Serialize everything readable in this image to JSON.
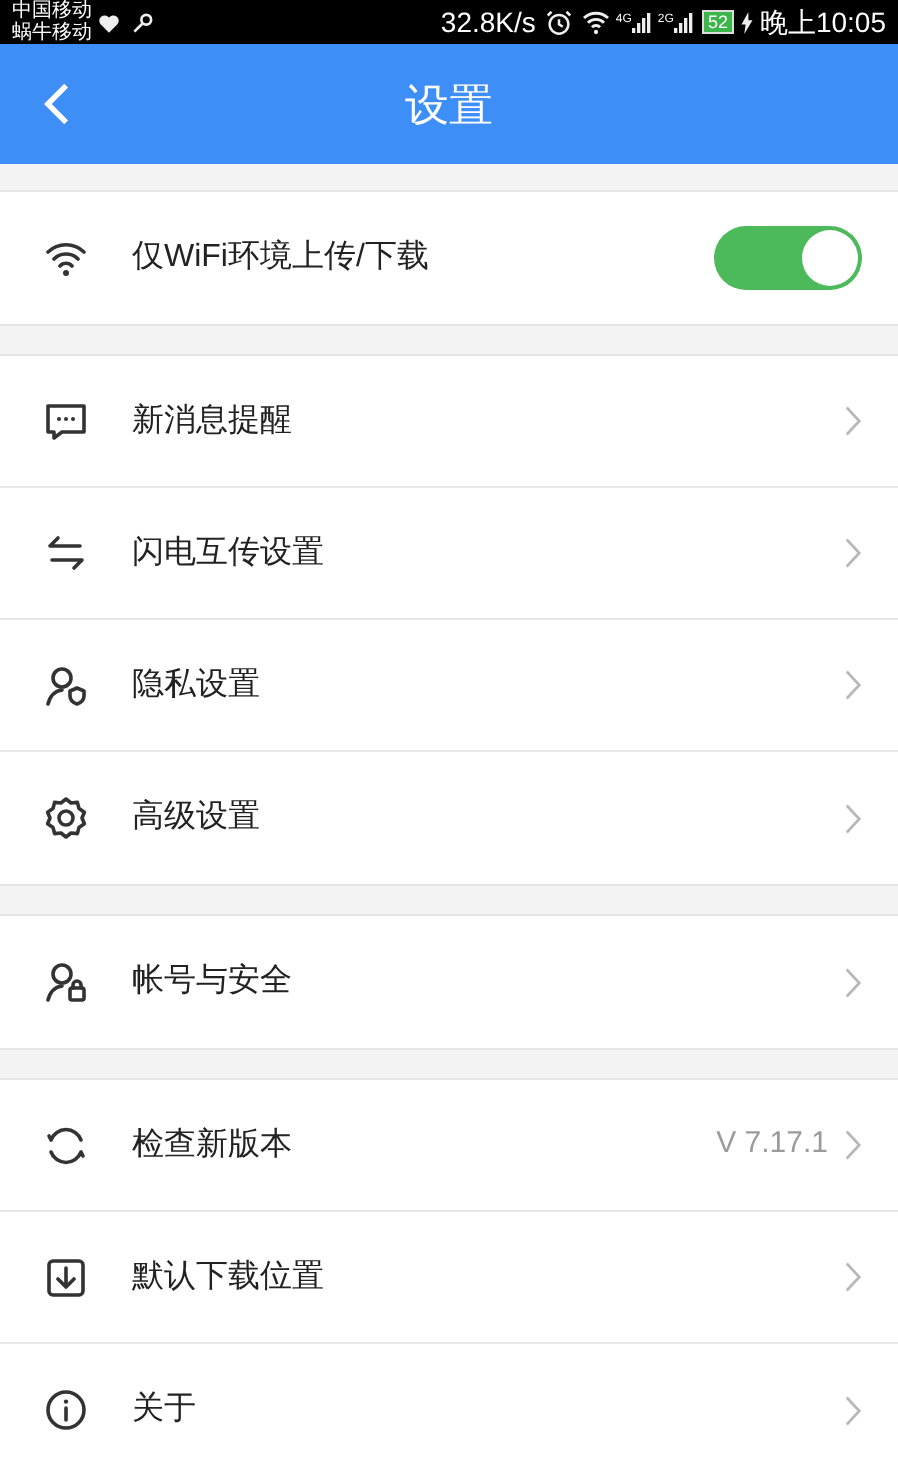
{
  "status_bar": {
    "carriers": [
      "中国移动",
      "蜗牛移动"
    ],
    "speed": "32.8K/s",
    "network_1": "4G",
    "network_2": "2G",
    "battery": "52",
    "time": "晚上10:05"
  },
  "header": {
    "title": "设置"
  },
  "sections": [
    {
      "items": [
        {
          "kind": "toggle",
          "label": "仅WiFi环境上传/下载",
          "on": true
        }
      ]
    },
    {
      "items": [
        {
          "kind": "link",
          "label": "新消息提醒"
        },
        {
          "kind": "link",
          "label": "闪电互传设置"
        },
        {
          "kind": "link",
          "label": "隐私设置"
        },
        {
          "kind": "link",
          "label": "高级设置"
        }
      ]
    },
    {
      "items": [
        {
          "kind": "link",
          "label": "帐号与安全"
        }
      ]
    },
    {
      "items": [
        {
          "kind": "link",
          "label": "检查新版本",
          "value": "V 7.17.1"
        },
        {
          "kind": "link",
          "label": "默认下载位置"
        },
        {
          "kind": "link",
          "label": "关于"
        }
      ]
    }
  ]
}
